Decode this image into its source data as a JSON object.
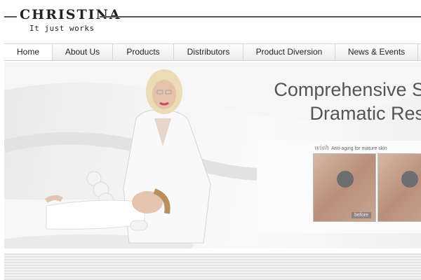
{
  "header": {
    "brand": "CHRISTINA",
    "tagline": "It just works"
  },
  "nav": {
    "items": [
      {
        "label": "Home",
        "active": true
      },
      {
        "label": "About Us"
      },
      {
        "label": "Products"
      },
      {
        "label": "Distributors"
      },
      {
        "label": "Product Diversion"
      },
      {
        "label": "News & Events"
      }
    ]
  },
  "hero": {
    "headline_line1": "Comprehensive So",
    "headline_line2": "Dramatic Resu",
    "product": {
      "brand": "wish",
      "caption": "Anti-aging for mature skin",
      "before_label": "before"
    }
  },
  "colors": {
    "text": "#222222",
    "headline": "#555555",
    "rule": "#555555"
  }
}
